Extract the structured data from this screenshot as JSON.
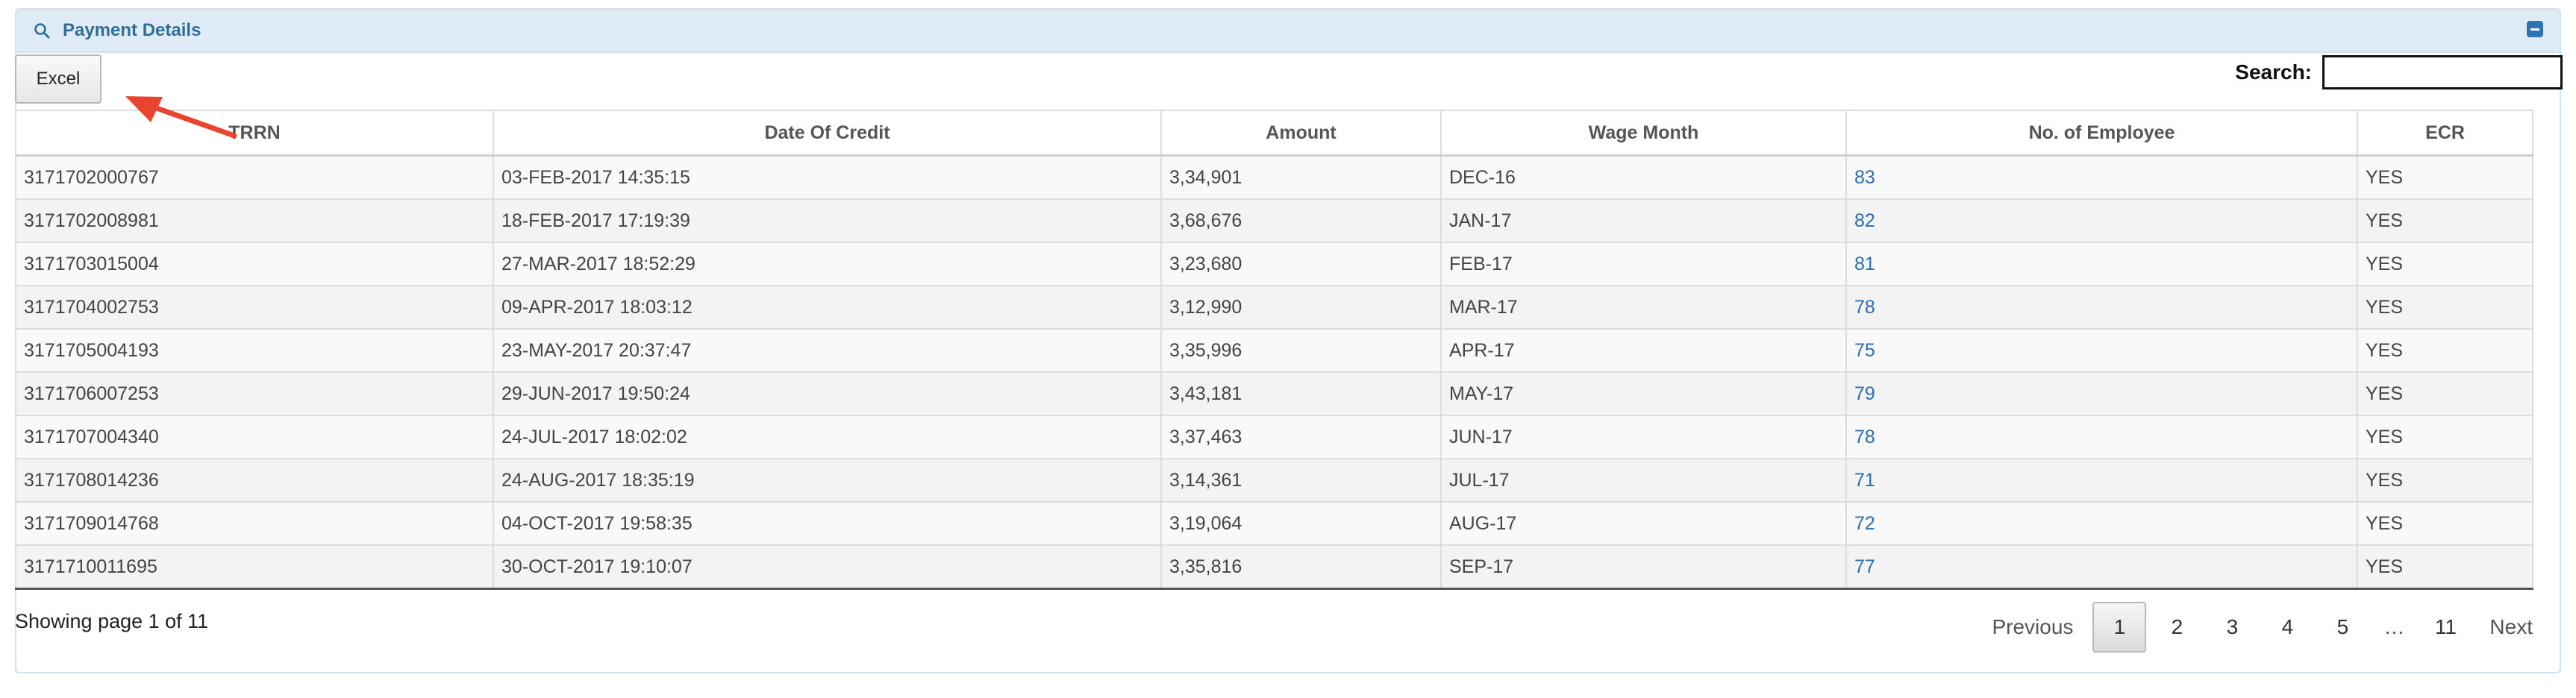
{
  "panel": {
    "title": "Payment Details",
    "title_icon": "search-icon",
    "collapse_icon": "minus-square-icon",
    "accent_color": "#2f6f96"
  },
  "toolbar": {
    "excel_label": "Excel",
    "search_label": "Search:",
    "search_value": ""
  },
  "table": {
    "columns": [
      "TRRN",
      "Date Of Credit",
      "Amount",
      "Wage Month",
      "No. of Employee",
      "ECR"
    ],
    "rows": [
      [
        "3171702000767",
        "03-FEB-2017 14:35:15",
        "3,34,901",
        "DEC-16",
        "83",
        "YES"
      ],
      [
        "3171702008981",
        "18-FEB-2017 17:19:39",
        "3,68,676",
        "JAN-17",
        "82",
        "YES"
      ],
      [
        "3171703015004",
        "27-MAR-2017 18:52:29",
        "3,23,680",
        "FEB-17",
        "81",
        "YES"
      ],
      [
        "3171704002753",
        "09-APR-2017 18:03:12",
        "3,12,990",
        "MAR-17",
        "78",
        "YES"
      ],
      [
        "3171705004193",
        "23-MAY-2017 20:37:47",
        "3,35,996",
        "APR-17",
        "75",
        "YES"
      ],
      [
        "3171706007253",
        "29-JUN-2017 19:50:24",
        "3,43,181",
        "MAY-17",
        "79",
        "YES"
      ],
      [
        "3171707004340",
        "24-JUL-2017 18:02:02",
        "3,37,463",
        "JUN-17",
        "78",
        "YES"
      ],
      [
        "3171708014236",
        "24-AUG-2017 18:35:19",
        "3,14,361",
        "JUL-17",
        "71",
        "YES"
      ],
      [
        "3171709014768",
        "04-OCT-2017 19:58:35",
        "3,19,064",
        "AUG-17",
        "72",
        "YES"
      ],
      [
        "3171710011695",
        "30-OCT-2017 19:10:07",
        "3,35,816",
        "SEP-17",
        "77",
        "YES"
      ]
    ],
    "link_color": "#2a6db1"
  },
  "footer": {
    "showing": "Showing page 1 of 11",
    "previous": "Previous",
    "next": "Next",
    "pages": [
      "1",
      "2",
      "3",
      "4",
      "5",
      "…",
      "11"
    ],
    "active_page": "1"
  },
  "annotation": {
    "arrow_color": "#e8452f",
    "arrow_icon": "red-arrow-pointing-at-excel-button"
  }
}
